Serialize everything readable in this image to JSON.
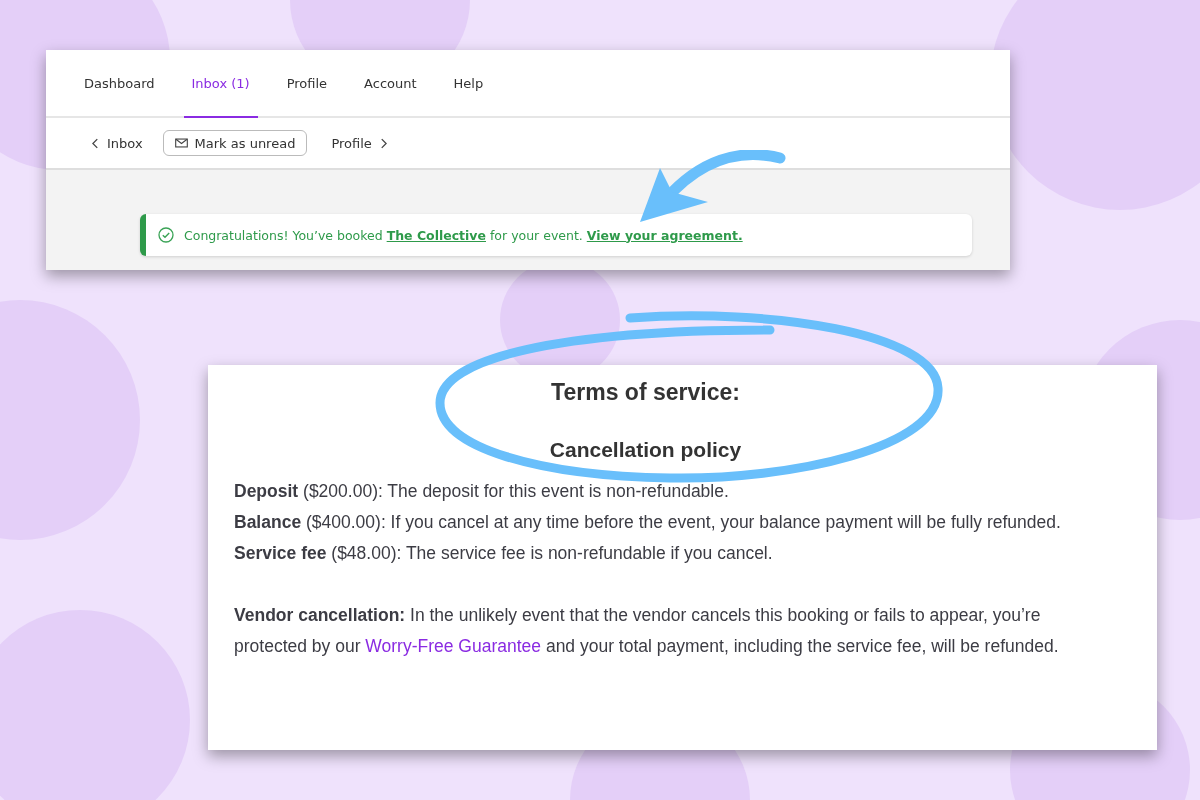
{
  "tabs": [
    {
      "label": "Dashboard",
      "selected": false
    },
    {
      "label": "Inbox (1)",
      "selected": true
    },
    {
      "label": "Profile",
      "selected": false
    },
    {
      "label": "Account",
      "selected": false
    },
    {
      "label": "Help",
      "selected": false
    }
  ],
  "toolbar": {
    "back": "Inbox",
    "mark_button": "Mark as unread",
    "next": "Profile"
  },
  "alert": {
    "segments": [
      {
        "kind": "text",
        "text": "Congratulations! You’ve booked "
      },
      {
        "kind": "link",
        "text": "The Collective"
      },
      {
        "kind": "text",
        "text": " for your event. "
      },
      {
        "kind": "link",
        "text": "View your agreement."
      }
    ]
  },
  "terms": {
    "title": "Terms of service:",
    "subtitle": "Cancellation policy",
    "paragraphs": [
      {
        "segments": [
          {
            "kind": "text",
            "text": "**Deposit** ($200.00): The deposit for this event is non-refundable."
          }
        ]
      },
      {
        "segments": [
          {
            "kind": "text",
            "text": "**Balance** ($400.00): If you cancel at any time before the event, your balance payment will be fully refunded."
          }
        ]
      },
      {
        "segments": [
          {
            "kind": "text",
            "text": "**Service fee** ($48.00): The service fee is non-refundable if you cancel."
          }
        ]
      },
      {
        "gap": true,
        "segments": [
          {
            "kind": "text",
            "text": "**Vendor cancellation:** In the unlikely event that the vendor cancels this booking or fails to appear, you’re protected by our "
          },
          {
            "kind": "link",
            "text": "Worry-Free Guarantee"
          },
          {
            "kind": "text",
            "text": " and your total payment, including the service fee, will be refunded."
          }
        ]
      }
    ]
  }
}
